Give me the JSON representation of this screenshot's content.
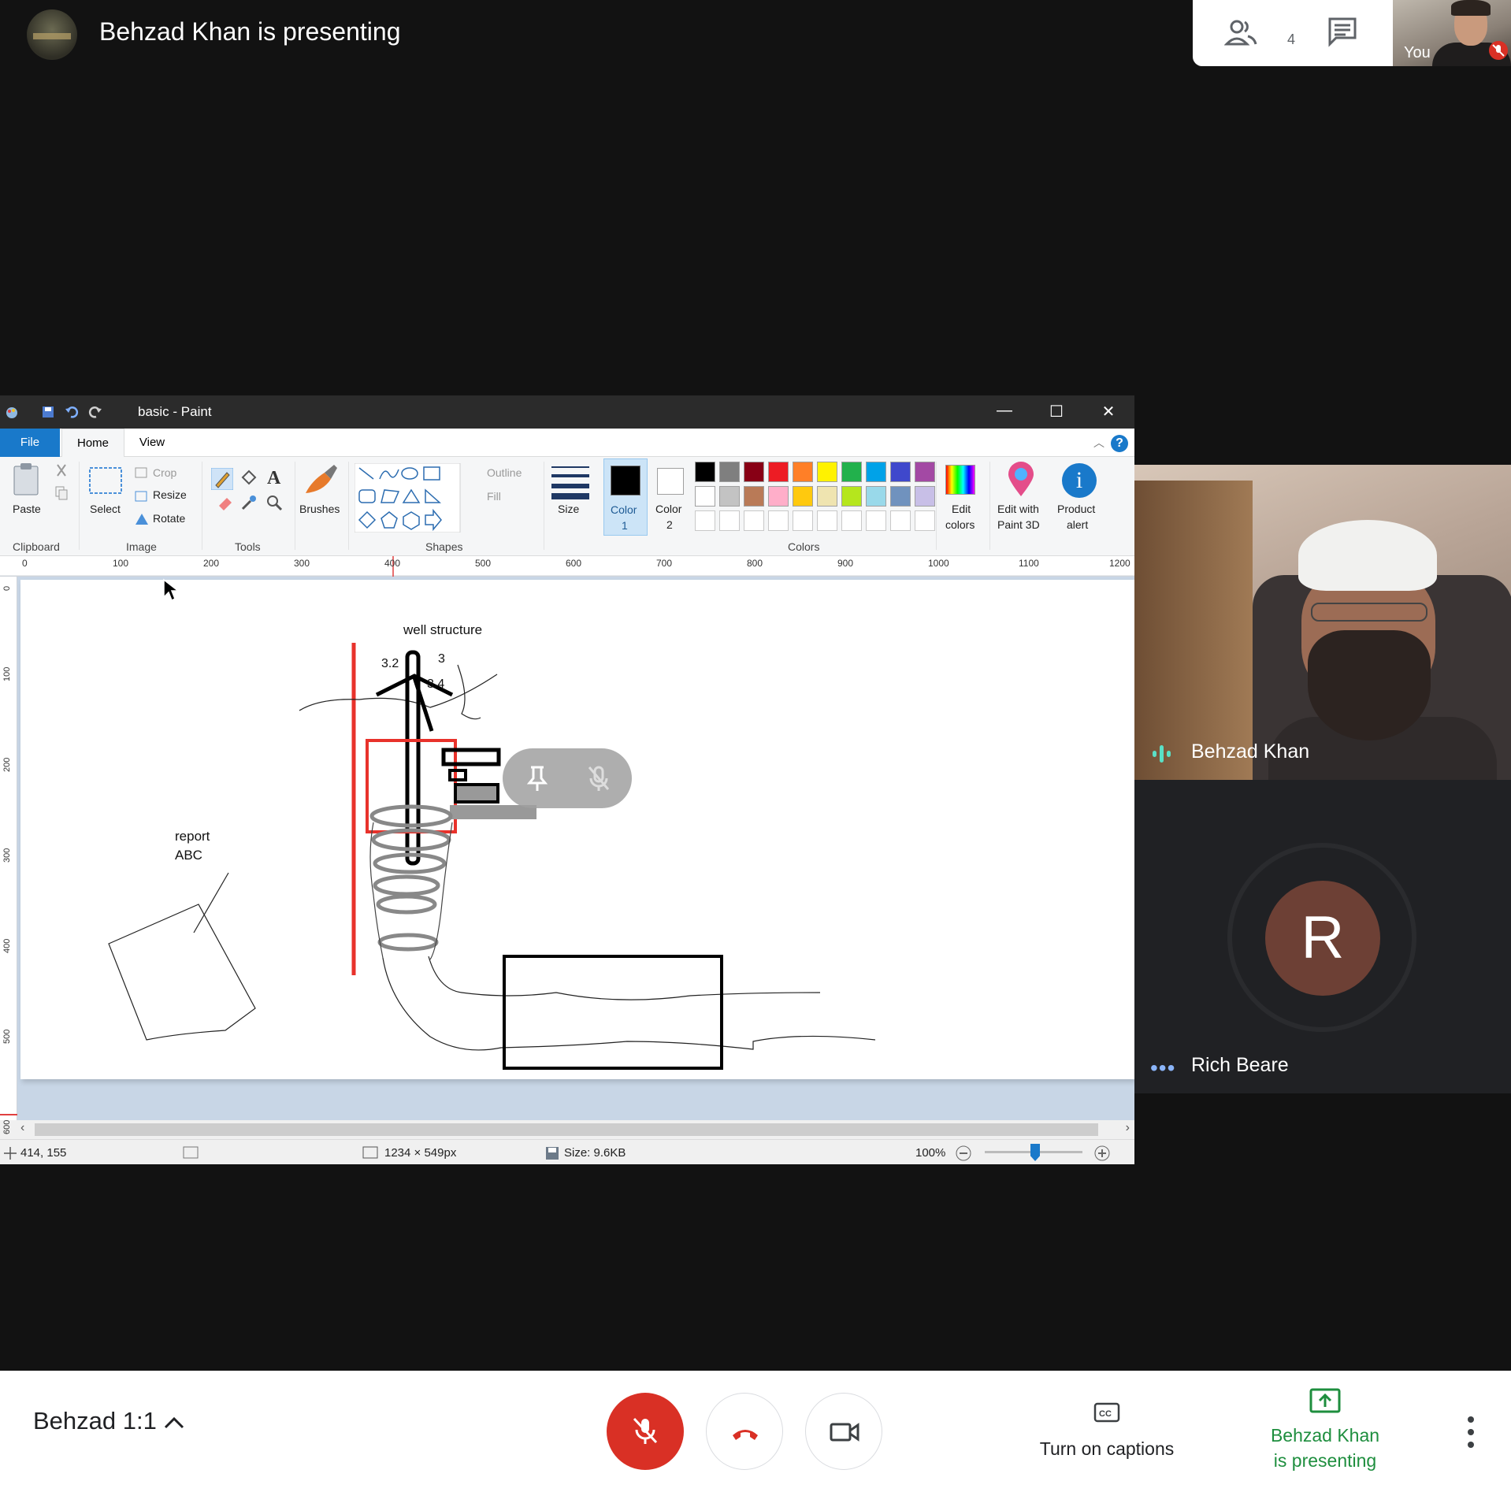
{
  "top_bar": {
    "presenting_text": "Behzad Khan is presenting",
    "people_count": "4",
    "self_label": "You"
  },
  "paint": {
    "window_title": "basic - Paint",
    "tabs": [
      "File",
      "Home",
      "View"
    ],
    "clipboard": {
      "paste": "Paste",
      "group": "Clipboard"
    },
    "image": {
      "select": "Select",
      "crop": "Crop",
      "resize": "Resize",
      "rotate": "Rotate",
      "group": "Image"
    },
    "tools": {
      "group": "Tools"
    },
    "brushes": "Brushes",
    "shapes": {
      "outline": "Outline",
      "fill": "Fill",
      "group": "Shapes"
    },
    "size": "Size",
    "color1": [
      "Color",
      "1"
    ],
    "color2": [
      "Color",
      "2"
    ],
    "colors_group": "Colors",
    "edit_colors": [
      "Edit",
      "colors"
    ],
    "paint3d": [
      "Edit with",
      "Paint 3D"
    ],
    "product_alert": [
      "Product",
      "alert"
    ],
    "palette_row1": [
      "#000000",
      "#7f7f7f",
      "#880015",
      "#ed1c24",
      "#ff7f27",
      "#fff200",
      "#22b14c",
      "#00a2e8",
      "#3f48cc",
      "#a349a4"
    ],
    "palette_row2": [
      "#ffffff",
      "#c3c3c3",
      "#b97a57",
      "#ffaec9",
      "#ffc90e",
      "#efe4b0",
      "#b5e61d",
      "#99d9ea",
      "#7092be",
      "#c8bfe7"
    ],
    "ruler_h": [
      "0",
      "100",
      "200",
      "300",
      "400",
      "500",
      "600",
      "700",
      "800",
      "900",
      "1000",
      "1100",
      "1200"
    ],
    "ruler_v": [
      "0",
      "100",
      "200",
      "300",
      "400",
      "500",
      "600"
    ],
    "drawing": {
      "title": "well structure",
      "label_32": "3.2",
      "label_3": "3",
      "label_34": "3.4",
      "report": "report",
      "abc": "ABC"
    },
    "status": {
      "cursor_pos": "414, 155",
      "dimensions": "1234 × 549px",
      "file_size": "Size: 9.6KB",
      "zoom": "100%"
    }
  },
  "participants": [
    {
      "name": "Behzad Khan"
    },
    {
      "name": "Rich Beare",
      "initial": "R"
    }
  ],
  "bottom_bar": {
    "meeting_name": "Behzad 1:1",
    "captions_label": "Turn on captions",
    "presenting_line1": "Behzad Khan",
    "presenting_line2": "is presenting"
  }
}
